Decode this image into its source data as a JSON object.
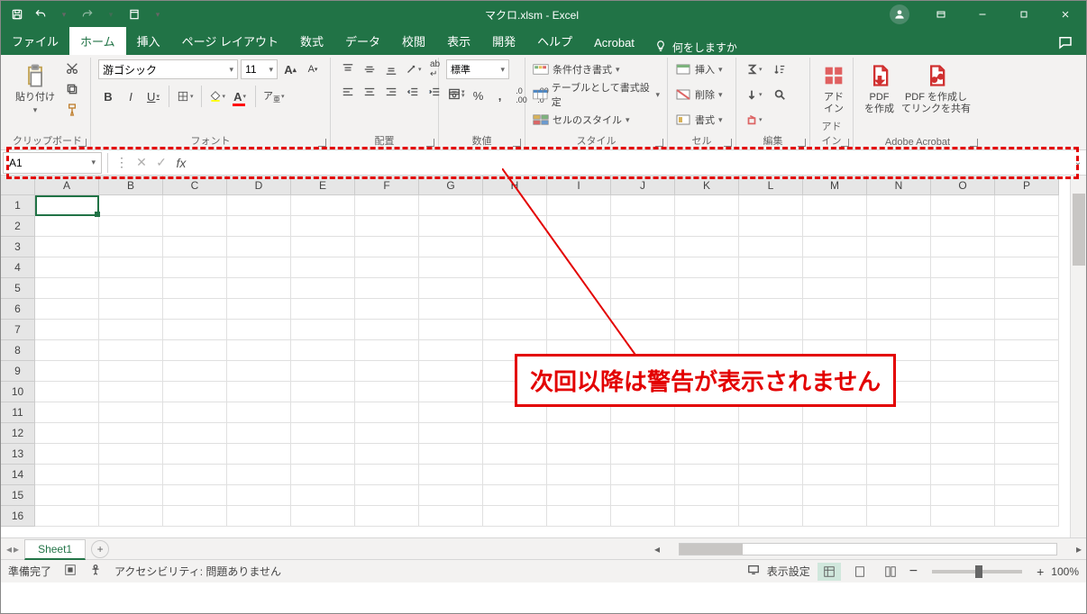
{
  "title": {
    "filename": "マクロ.xlsm",
    "app": "Excel",
    "full": "マクロ.xlsm  -  Excel"
  },
  "tabs": {
    "file": "ファイル",
    "home": "ホーム",
    "insert": "挿入",
    "pageLayout": "ページ レイアウト",
    "formulas": "数式",
    "data": "データ",
    "review": "校閲",
    "view": "表示",
    "developer": "開発",
    "help": "ヘルプ",
    "acrobat": "Acrobat"
  },
  "tellMe": "何をしますか",
  "ribbon": {
    "clipboard": {
      "paste": "貼り付け",
      "group": "クリップボード"
    },
    "font": {
      "name": "游ゴシック",
      "size": "11",
      "group": "フォント"
    },
    "align": {
      "group": "配置"
    },
    "number": {
      "format": "標準",
      "group": "数値"
    },
    "styles": {
      "cond": "条件付き書式",
      "table": "テーブルとして書式設定",
      "cell": "セルのスタイル",
      "group": "スタイル"
    },
    "cells": {
      "insert": "挿入",
      "delete": "削除",
      "format": "書式",
      "group": "セル"
    },
    "editing": {
      "group": "編集"
    },
    "addins": {
      "label": "アド\nイン",
      "group": "アドイン"
    },
    "acrobat": {
      "create": "PDF\nを作成",
      "share": "PDF を作成し\nてリンクを共有",
      "group": "Adobe Acrobat"
    }
  },
  "nameBox": "A1",
  "columns": [
    "A",
    "B",
    "C",
    "D",
    "E",
    "F",
    "G",
    "H",
    "I",
    "J",
    "K",
    "L",
    "M",
    "N",
    "O",
    "P"
  ],
  "rowCount": 16,
  "sheet": {
    "name": "Sheet1"
  },
  "status": {
    "ready": "準備完了",
    "acc": "アクセシビリティ: 問題ありません",
    "display": "表示設定",
    "zoom": "100%",
    "minus": "−",
    "plus": "+"
  },
  "callout": "次回以降は警告が表示されません"
}
